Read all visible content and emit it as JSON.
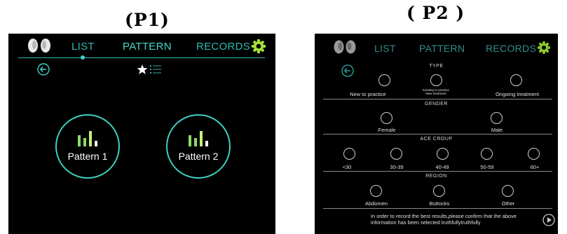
{
  "captions": {
    "p1": "(P1)",
    "p2": "( P2 )"
  },
  "nav": {
    "list": "LIST",
    "pattern": "PATTERN",
    "records": "RECORDS"
  },
  "colors": {
    "accent": "#3fd0c0",
    "background": "#000000",
    "bar_bright": "#c6f07a",
    "bar_mid": "#8fd86a"
  },
  "p1": {
    "patterns": [
      {
        "label": "Pattern 1"
      },
      {
        "label": "Pattern 2"
      }
    ],
    "icons": [
      "earbuds-icon",
      "back-arrow-icon",
      "star-icon",
      "list-icon",
      "gear-icon",
      "bars-icon"
    ]
  },
  "p2": {
    "sections": {
      "type": {
        "title": "TYPE",
        "options": [
          {
            "label": "New to practice"
          },
          {
            "label": "Existing to practice\nNew treatment"
          },
          {
            "label": "Ongoing treatment"
          }
        ]
      },
      "gender": {
        "title": "GENDER",
        "options": [
          {
            "label": "Female"
          },
          {
            "label": "Male"
          }
        ]
      },
      "age": {
        "title": "ACE CROUP",
        "options": [
          {
            "label": "<30"
          },
          {
            "label": "30-39"
          },
          {
            "label": "40-49"
          },
          {
            "label": "50-59"
          },
          {
            "label": "60+"
          }
        ]
      },
      "region": {
        "title": "REGION",
        "options": [
          {
            "label": "Abdomen"
          },
          {
            "label": "Buttocks"
          },
          {
            "label": "Other"
          }
        ]
      }
    },
    "notice": "In order to record the best results,please confirm that the above information has been selected truthfullytruthfully"
  }
}
